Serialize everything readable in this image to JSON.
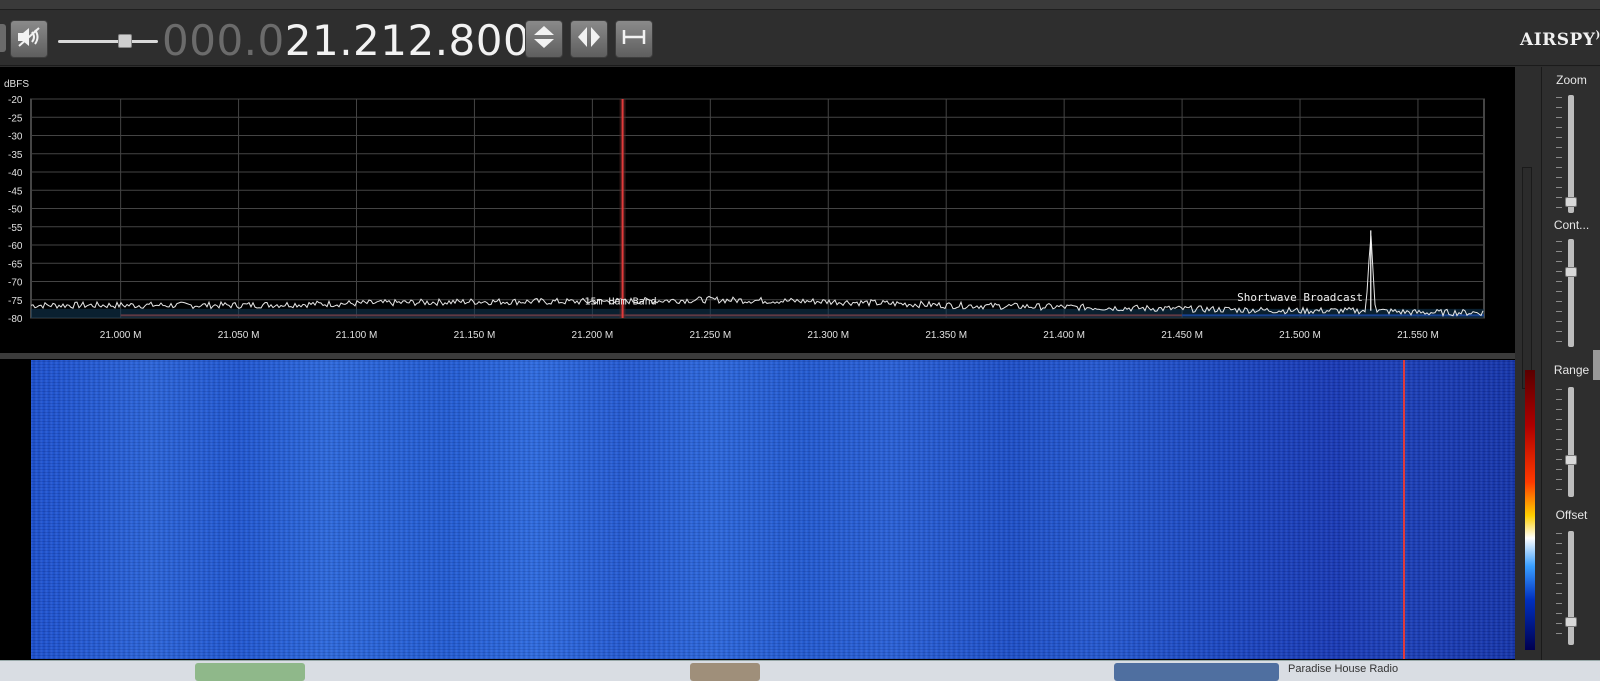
{
  "toolbar": {
    "frequency_dim": "000.0",
    "frequency_bright": "21.212.800",
    "logo_text": "AIRSPY",
    "icons": [
      "speaker-mute-icon",
      "tune-up-down-icon",
      "tune-left-right-icon",
      "span-icon"
    ]
  },
  "spectrum": {
    "unit_label": "dBFS",
    "y_ticks": [
      "-20",
      "-25",
      "-30",
      "-35",
      "-40",
      "-45",
      "-50",
      "-55",
      "-60",
      "-65",
      "-70",
      "-75",
      "-80"
    ],
    "x_ticks": [
      "21.000 M",
      "21.050 M",
      "21.100 M",
      "21.150 M",
      "21.200 M",
      "21.250 M",
      "21.300 M",
      "21.350 M",
      "21.400 M",
      "21.450 M",
      "21.500 M",
      "21.550 M"
    ],
    "band_label_1": "15m Ham Band",
    "band_label_2": "Shortwave Broadcast",
    "side_value": "2"
  },
  "chart_data": {
    "type": "line",
    "ylabel": "dBFS",
    "ylim": [
      -80,
      -20
    ],
    "xlim": [
      20.962,
      21.578
    ],
    "x_unit": "MHz",
    "series": [
      {
        "values_x": [
          20.962,
          21.0,
          21.05,
          21.1,
          21.15,
          21.2,
          21.25,
          21.3,
          21.35,
          21.4,
          21.45,
          21.5,
          21.528,
          21.53,
          21.532,
          21.55,
          21.578
        ],
        "values_y": [
          -76.5,
          -76.5,
          -76.5,
          -76.0,
          -75.5,
          -75.5,
          -75.0,
          -75.5,
          -76.5,
          -77.0,
          -77.5,
          -78.0,
          -78.0,
          -56.0,
          -78.0,
          -78.5,
          -78.5
        ]
      }
    ],
    "marker_x": 21.2128
  },
  "right_panel": {
    "zoom_label": "Zoom",
    "contrast_label": "Cont...",
    "range_label": "Range",
    "offset_label": "Offset"
  },
  "taskbar": {
    "text": "Paradise House Radio"
  }
}
